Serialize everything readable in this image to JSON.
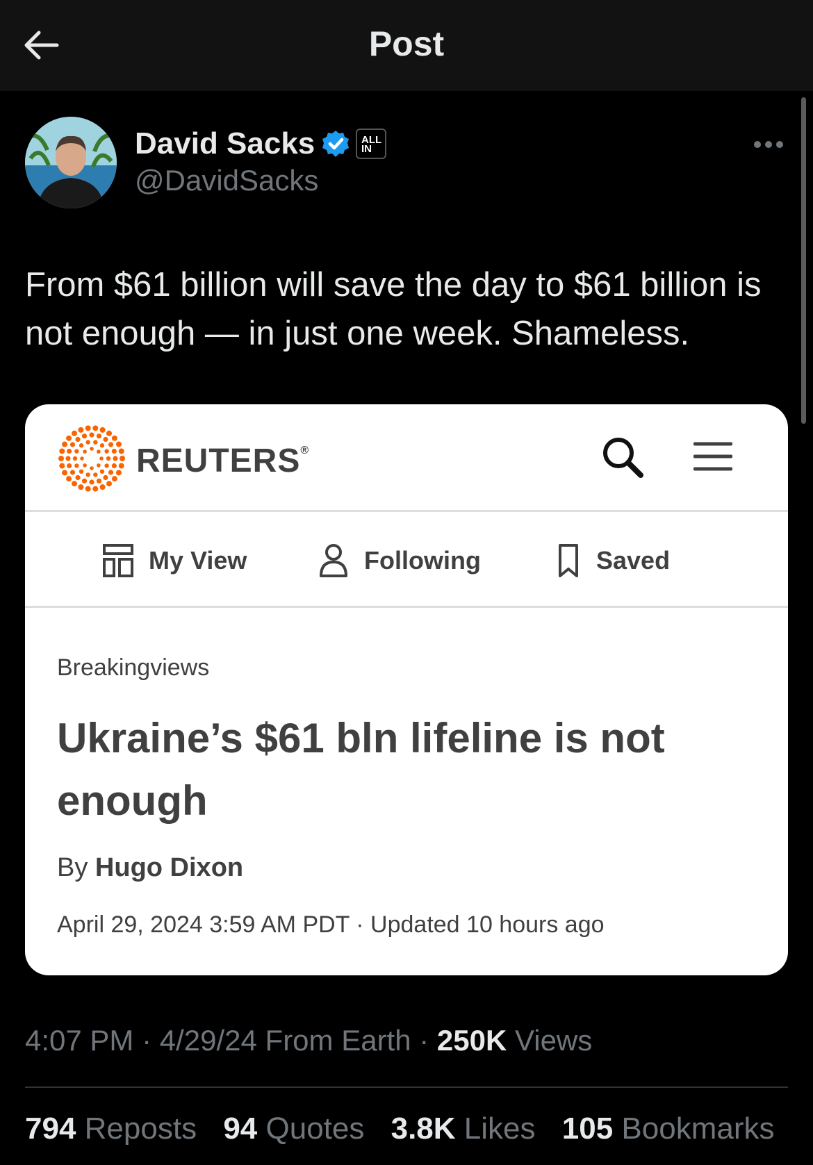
{
  "header": {
    "title": "Post",
    "back_icon": "arrow-left-icon"
  },
  "author": {
    "name": "David Sacks",
    "handle": "@DavidSacks",
    "badge_text_line1": "ALL",
    "badge_text_line2": "IN",
    "verified_color": "#1d9bf0"
  },
  "post": {
    "text": "From $61 billion will save the day to $61 billion is not enough — in just one week. Shameless."
  },
  "card": {
    "brand": "REUTERS",
    "brand_color": "#fa6400",
    "nav": [
      {
        "label": "My View",
        "icon": "layout-icon"
      },
      {
        "label": "Following",
        "icon": "person-icon"
      },
      {
        "label": "Saved",
        "icon": "bookmark-icon"
      }
    ],
    "kicker": "Breakingviews",
    "headline": "Ukraine’s $61 bln lifeline is not enough",
    "byline_prefix": "By",
    "author": "Hugo Dixon",
    "dateline": "April 29, 2024 3:59 AM PDT · Updated 10 hours ago"
  },
  "meta": {
    "time_date_location": "4:07 PM · 4/29/24 From Earth ·",
    "views_count": "250K",
    "views_label": "Views"
  },
  "stats": [
    {
      "count": "794",
      "label": "Reposts"
    },
    {
      "count": "94",
      "label": "Quotes"
    },
    {
      "count": "3.8K",
      "label": "Likes"
    },
    {
      "count": "105",
      "label": "Bookmarks"
    }
  ]
}
